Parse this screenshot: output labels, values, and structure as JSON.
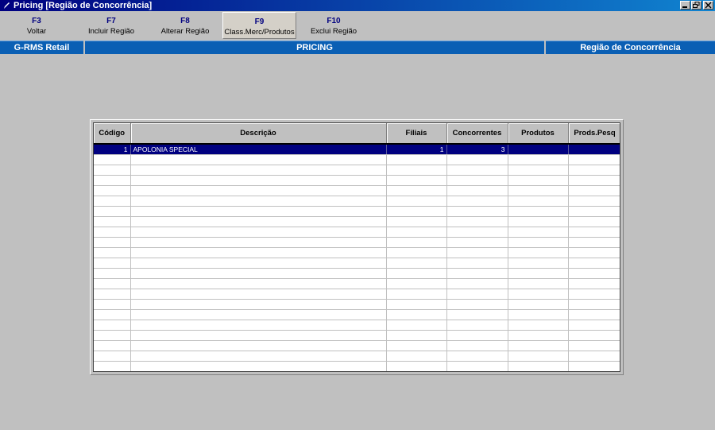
{
  "window": {
    "title": "Pricing  [Região de Concorrência]",
    "buttons": {
      "minimize": "minimize-icon",
      "restore": "restore-icon",
      "close": "close-icon"
    }
  },
  "toolbar": {
    "keys": [
      {
        "key": "F3",
        "label": "Voltar"
      },
      {
        "key": "F7",
        "label": "Incluir Região"
      },
      {
        "key": "F8",
        "label": "Alterar Região"
      },
      {
        "key": "F9",
        "label": "Class.Merc/Produtos"
      },
      {
        "key": "F10",
        "label": "Exclui Região"
      }
    ]
  },
  "header": {
    "left": "G-RMS Retail",
    "center": "PRICING",
    "right": "Região de Concorrência"
  },
  "colors": {
    "title_start": "#000080",
    "title_end": "#1084d0",
    "header_blue": "#0a5fb4",
    "selection": "#000080"
  },
  "grid": {
    "columns": [
      "Código",
      "Descrição",
      "Filiais",
      "Concorrentes",
      "Produtos",
      "Prods.Pesq"
    ],
    "rows": [
      {
        "codigo": "1",
        "descricao": "APOLONIA SPECIAL",
        "filiais": "1",
        "concorrentes": "3",
        "produtos": "",
        "prods_pesq": ""
      }
    ]
  }
}
